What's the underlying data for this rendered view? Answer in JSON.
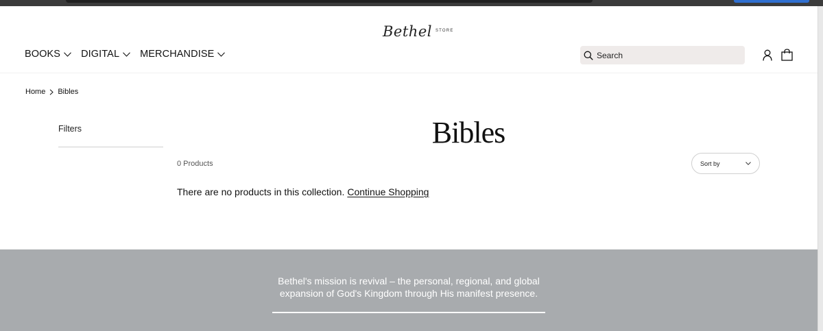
{
  "logo": {
    "script": "Bethel",
    "suffix": "STORE"
  },
  "nav": {
    "items": [
      {
        "label": "BOOKS"
      },
      {
        "label": "DIGITAL"
      },
      {
        "label": "MERCHANDISE"
      }
    ]
  },
  "search": {
    "placeholder": "Search"
  },
  "breadcrumb": {
    "home": "Home",
    "current": "Bibles"
  },
  "filters": {
    "label": "Filters"
  },
  "collection": {
    "title": "Bibles",
    "product_count": "0 Products",
    "sort_label": "Sort by",
    "empty_message": "There are no products in this collection.",
    "continue_link": "Continue Shopping"
  },
  "footer": {
    "mission_line1": "Bethel's mission is revival – the personal, regional, and global",
    "mission_line2": "expansion of God's Kingdom through His manifest presence."
  },
  "colors": {
    "footer_bg": "#a8abae",
    "search_bg": "#efebea",
    "browser_accent": "#2f6fd0"
  }
}
